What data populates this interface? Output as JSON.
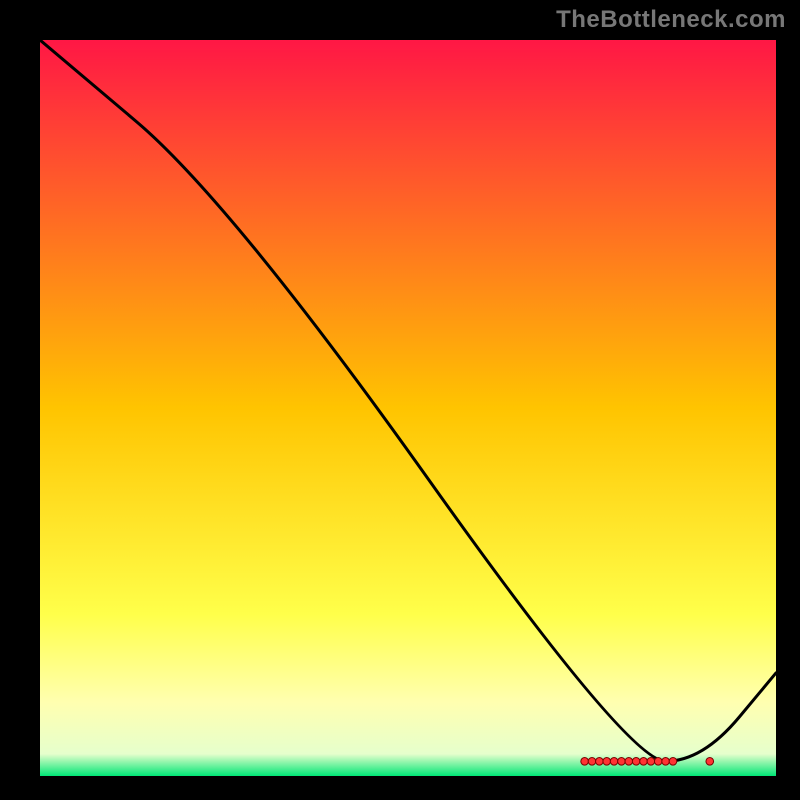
{
  "watermark": "TheBottleneck.com",
  "chart_data": {
    "type": "line",
    "title": "",
    "xlabel": "",
    "ylabel": "",
    "xlim": [
      0,
      100
    ],
    "ylim": [
      0,
      100
    ],
    "grid": false,
    "legend": false,
    "annotations": [],
    "series": [
      {
        "name": "curve",
        "x": [
          0,
          26,
          80,
          90,
          100
        ],
        "values": [
          100,
          78,
          2,
          2,
          14
        ]
      }
    ],
    "markers": {
      "name": "red-markers",
      "x": [
        74,
        75,
        76,
        77,
        78,
        79,
        80,
        81,
        82,
        83,
        84,
        85,
        86,
        91
      ],
      "values": [
        2,
        2,
        2,
        2,
        2,
        2,
        2,
        2,
        2,
        2,
        2,
        2,
        2,
        2
      ]
    },
    "background_gradient": {
      "stops": [
        {
          "offset": 0.0,
          "color": "#ff1745"
        },
        {
          "offset": 0.5,
          "color": "#ffc400"
        },
        {
          "offset": 0.78,
          "color": "#ffff4a"
        },
        {
          "offset": 0.9,
          "color": "#ffffb0"
        },
        {
          "offset": 0.97,
          "color": "#e6ffcc"
        },
        {
          "offset": 1.0,
          "color": "#00e676"
        }
      ]
    }
  },
  "colors": {
    "curve": "#000000",
    "marker_fill": "#ff3333",
    "marker_stroke": "#7a0000",
    "frame": "#000000"
  }
}
